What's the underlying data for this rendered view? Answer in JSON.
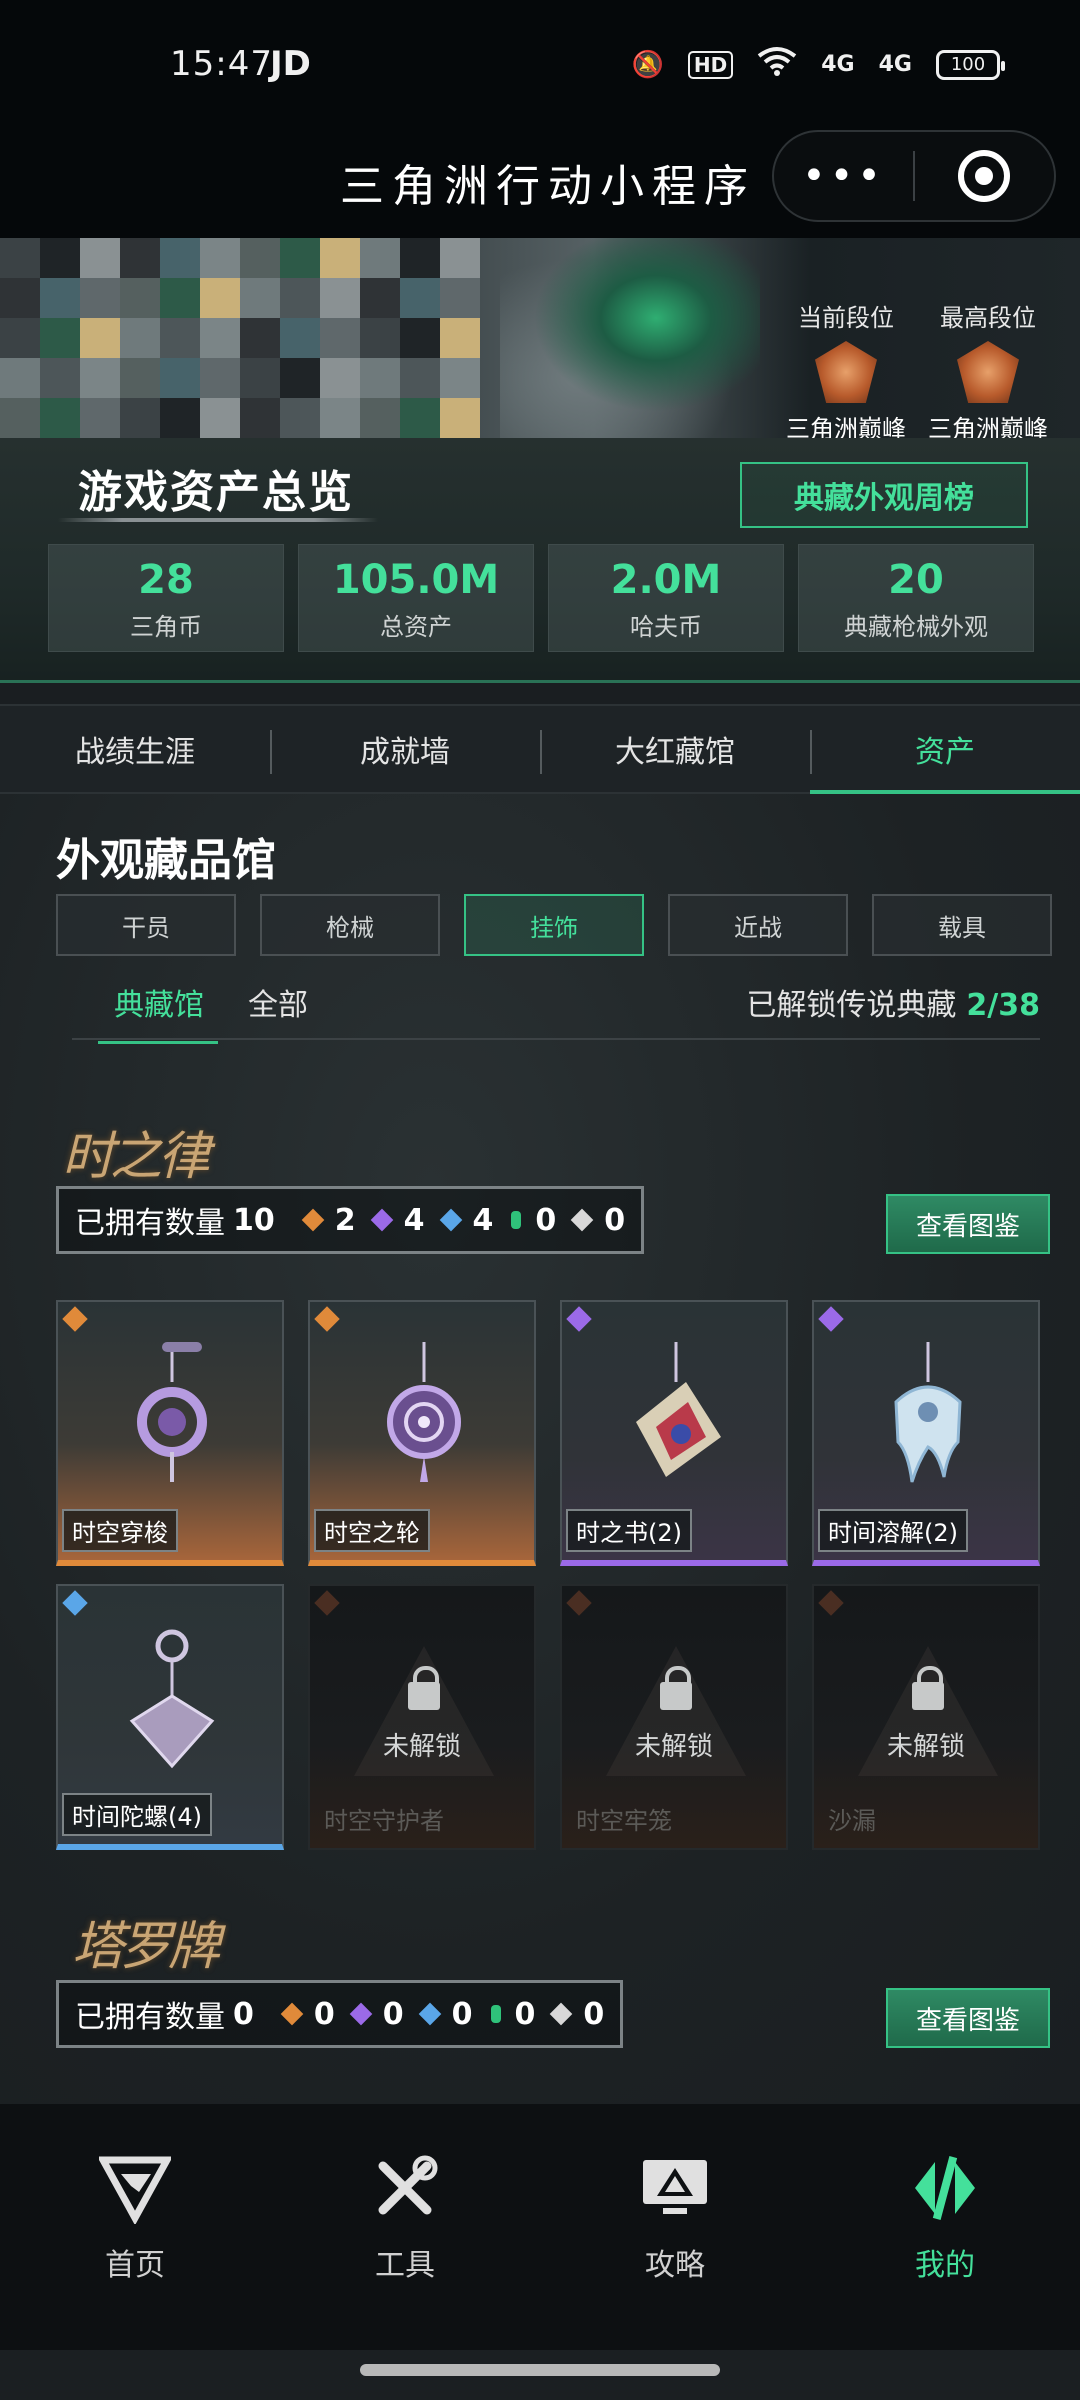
{
  "status_bar": {
    "time": "15:47",
    "carrier_badge": "JD",
    "hd_label": "HD",
    "signal_1": "4G",
    "signal_2": "4G",
    "battery": "100"
  },
  "title_bar": {
    "title": "三角洲行动小程序",
    "more_icon": "more-dots-icon",
    "close_icon": "target-circle-icon"
  },
  "banner": {
    "current_rank_label": "当前段位",
    "current_rank_name": "三角洲巅峰",
    "highest_rank_label": "最高段位",
    "highest_rank_name": "三角洲巅峰"
  },
  "overview": {
    "title": "游戏资产总览",
    "weekly_button": "典藏外观周榜",
    "stats": [
      {
        "value": "28",
        "label": "三角币"
      },
      {
        "value": "105.0M",
        "label": "总资产"
      },
      {
        "value": "2.0M",
        "label": "哈夫币"
      },
      {
        "value": "20",
        "label": "典藏枪械外观"
      }
    ]
  },
  "main_tabs": [
    {
      "label": "战绩生涯",
      "active": false
    },
    {
      "label": "成就墙",
      "active": false
    },
    {
      "label": "大红藏馆",
      "active": false
    },
    {
      "label": "资产",
      "active": true
    }
  ],
  "collection": {
    "title": "外观藏品馆",
    "categories": [
      {
        "label": "干员",
        "active": false
      },
      {
        "label": "枪械",
        "active": false
      },
      {
        "label": "挂饰",
        "active": true
      },
      {
        "label": "近战",
        "active": false
      },
      {
        "label": "载具",
        "active": false
      }
    ],
    "sub_tabs": [
      {
        "label": "典藏馆",
        "active": true
      },
      {
        "label": "全部",
        "active": false
      }
    ],
    "unlock_label": "已解锁传说典藏",
    "unlock_count": "2/38"
  },
  "series": [
    {
      "logo_text": "时之律",
      "owned_label": "已拥有数量",
      "owned_total": "10",
      "counts": {
        "orange": "2",
        "purple": "4",
        "blue": "4",
        "green": "0",
        "white": "0"
      },
      "atlas_button": "查看图鉴",
      "items": [
        {
          "name": "时空穿梭",
          "rarity": "orange",
          "locked": false
        },
        {
          "name": "时空之轮",
          "rarity": "orange",
          "locked": false
        },
        {
          "name": "时之书(2)",
          "rarity": "purple",
          "locked": false
        },
        {
          "name": "时间溶解(2)",
          "rarity": "purple",
          "locked": false
        },
        {
          "name": "时间陀螺(4)",
          "rarity": "blue",
          "locked": false
        },
        {
          "name": "时空守护者",
          "rarity": "orange",
          "locked": true
        },
        {
          "name": "时空牢笼",
          "rarity": "orange",
          "locked": true
        },
        {
          "name": "沙漏",
          "rarity": "orange",
          "locked": true
        }
      ],
      "locked_text": "未解锁"
    },
    {
      "logo_text": "塔罗牌",
      "owned_label": "已拥有数量",
      "owned_total": "0",
      "counts": {
        "orange": "0",
        "purple": "0",
        "blue": "0",
        "green": "0",
        "white": "0"
      },
      "atlas_button": "查看图鉴"
    }
  ],
  "bottom_nav": [
    {
      "label": "首页",
      "icon": "home-logo-icon",
      "active": false
    },
    {
      "label": "工具",
      "icon": "tools-icon",
      "active": false
    },
    {
      "label": "攻略",
      "icon": "guide-monitor-icon",
      "active": false
    },
    {
      "label": "我的",
      "icon": "profile-logo-icon",
      "active": true
    }
  ],
  "colors": {
    "accent": "#44e09b",
    "orange_rarity": "#e08a3a",
    "purple_rarity": "#9b6ae8",
    "blue_rarity": "#5aa6e8"
  }
}
